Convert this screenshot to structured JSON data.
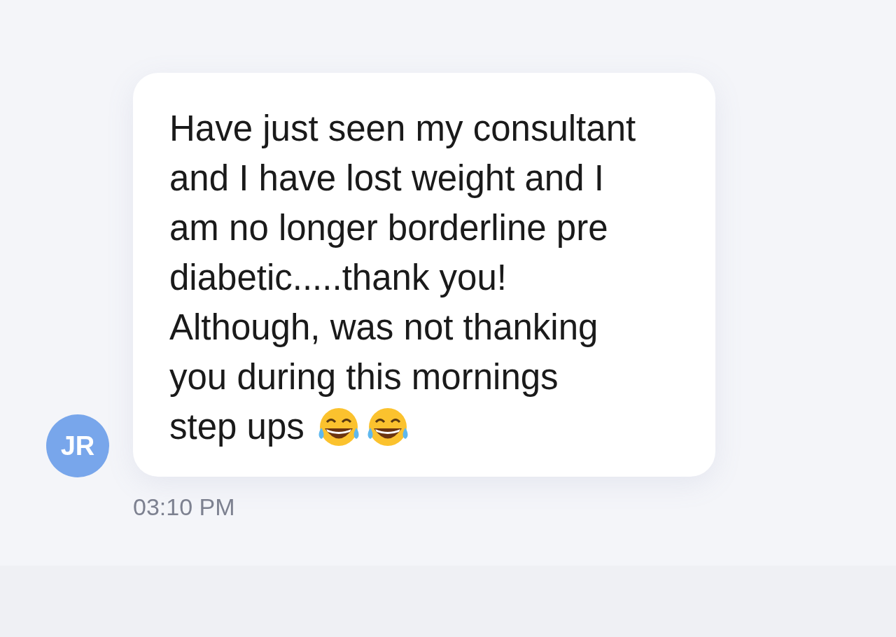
{
  "message": {
    "avatar": {
      "initials": "JR"
    },
    "text": "Have just seen my consultant\nand I have lost weight and I\nam no longer borderline pre\ndiabetic.....thank you!\nAlthough, was not thanking\nyou during this mornings\nstep ups",
    "emojis": [
      {
        "kind": "tears-of-joy"
      },
      {
        "kind": "tears-of-joy"
      }
    ],
    "time": "03:10 PM"
  }
}
